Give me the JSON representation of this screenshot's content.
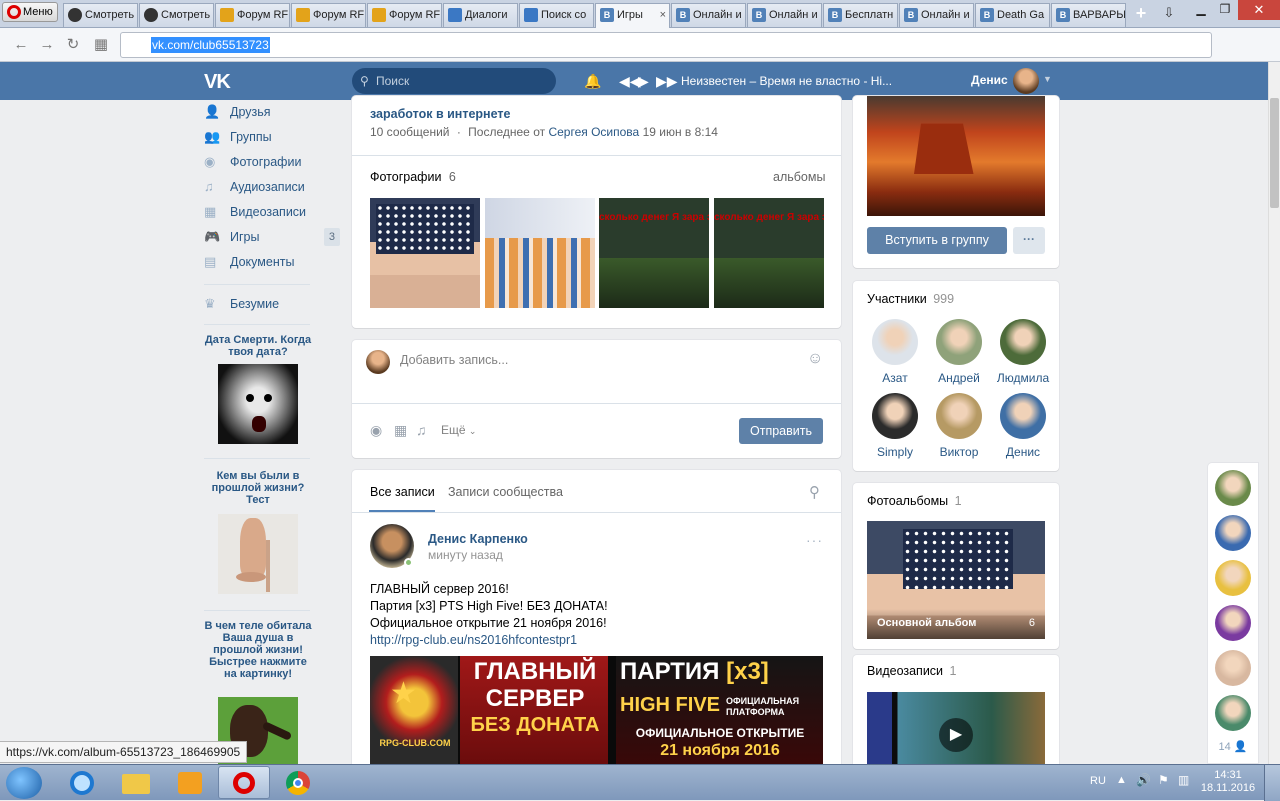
{
  "browser": {
    "menu_label": "Меню",
    "tabs": [
      {
        "label": "Смотреть",
        "kind": "face"
      },
      {
        "label": "Смотреть",
        "kind": "face"
      },
      {
        "label": "Форум RF",
        "kind": "forum"
      },
      {
        "label": "Форум RF",
        "kind": "forum"
      },
      {
        "label": "Форум RF",
        "kind": "forum"
      },
      {
        "label": "Диалоги",
        "kind": "msg"
      },
      {
        "label": "Поиск со",
        "kind": "search"
      },
      {
        "label": "Игры",
        "kind": "vk",
        "active": true
      },
      {
        "label": "Онлайн и",
        "kind": "vk"
      },
      {
        "label": "Онлайн и",
        "kind": "vk"
      },
      {
        "label": "Бесплатн",
        "kind": "vk"
      },
      {
        "label": "Онлайн и",
        "kind": "vk"
      },
      {
        "label": "Death Ga",
        "kind": "vk"
      },
      {
        "label": "ВАРВАРЫ",
        "kind": "vk"
      }
    ],
    "new_tab": "+",
    "url": "vk.com/club65513723",
    "status_link": "https://vk.com/album-65513723_186469905"
  },
  "header": {
    "logo": "VK",
    "search_placeholder": "Поиск",
    "now_playing": "Неизвестен – Время не властно - Hi...",
    "user_name": "Денис"
  },
  "left_nav": {
    "items": [
      {
        "label": "Друзья",
        "icon": "friends-icon"
      },
      {
        "label": "Группы",
        "icon": "groups-icon"
      },
      {
        "label": "Фотографии",
        "icon": "camera-icon"
      },
      {
        "label": "Аудиозаписи",
        "icon": "music-icon"
      },
      {
        "label": "Видеозаписи",
        "icon": "video-icon"
      },
      {
        "label": "Игры",
        "icon": "gamepad-icon",
        "badge": "3"
      },
      {
        "label": "Документы",
        "icon": "document-icon"
      }
    ],
    "extra": {
      "label": "Безумие",
      "icon": "crown-icon"
    },
    "ads": [
      {
        "title": "Дата Смерти. Когда твоя дата?"
      },
      {
        "title": "Кем вы были в прошлой жизни? Тест"
      },
      {
        "title": "В чем теле обитала Ваша душа в прошлой жизни! Быстрее нажмите на картинку!"
      }
    ]
  },
  "discussion": {
    "title": "заработок в интернете",
    "count": "10 сообщений",
    "sep": "·",
    "last_prefix": "Последнее от",
    "last_author": "Сергея Осипова",
    "last_time": "19 июн в 8:14"
  },
  "photos": {
    "title": "Фотографии",
    "count": "6",
    "albums_link": "альбомы",
    "thumb_text": "сколько денег Я зара этой игре!"
  },
  "composer": {
    "placeholder": "Добавить запись...",
    "more_label": "Ещё",
    "send_label": "Отправить"
  },
  "wall": {
    "tabs": [
      "Все записи",
      "Записи сообщества"
    ],
    "post": {
      "author": "Денис Карпенко",
      "time": "минуту назад",
      "lines": [
        "ГЛАВНЫЙ сервер 2016!",
        "Партия [x3] PTS High Five! БЕЗ ДОНАТА!",
        "Официальное открытие 21 ноября 2016!"
      ],
      "link": "http://rpg-club.eu/ns2016hfcontestpr1",
      "banner": {
        "logo_text": "RPG-CLUB.COM",
        "left_line1": "ГЛАВНЫЙ",
        "left_line2": "СЕРВЕР",
        "left_line3": "БЕЗ ДОНАТА",
        "right_line1": "ПАРТИЯ",
        "right_x3": "[x3]",
        "right_line2": "HIGH FIVE",
        "right_small": "ОФИЦИАЛЬНАЯ ПЛАТФОРМА",
        "right_line3": "ОФИЦИАЛЬНОЕ ОТКРЫТИЕ",
        "right_line4": "21 ноября 2016"
      }
    }
  },
  "right": {
    "join_label": "Вступить в группу",
    "more_label": "···",
    "members": {
      "title": "Участники",
      "count": "999",
      "list": [
        {
          "name": "Азат",
          "color": "#dde3ea"
        },
        {
          "name": "Андрей",
          "color": "#8fa27a"
        },
        {
          "name": "Людмила",
          "color": "#4d6b3a"
        },
        {
          "name": "Simply",
          "color": "#2b2b2b"
        },
        {
          "name": "Виктор",
          "color": "#b69a64"
        },
        {
          "name": "Денис",
          "color": "#3f6fa5"
        }
      ]
    },
    "albums": {
      "title": "Фотоальбомы",
      "count": "1",
      "album_name": "Основной альбом",
      "album_count": "6"
    },
    "videos": {
      "title": "Видеозаписи",
      "count": "1"
    }
  },
  "chat_rail": {
    "count": "14"
  },
  "taskbar": {
    "lang": "RU",
    "time": "14:31",
    "date": "18.11.2016"
  }
}
